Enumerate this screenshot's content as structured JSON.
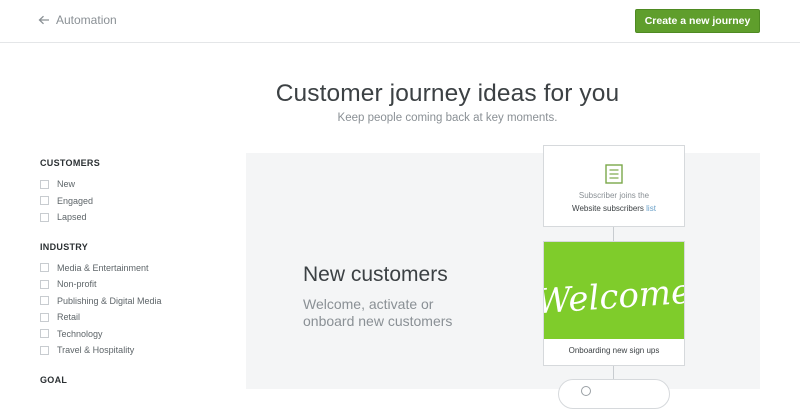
{
  "header": {
    "back_label": "Automation",
    "cta_label": "Create a new journey"
  },
  "hero": {
    "title": "Customer journey ideas for you",
    "subtitle": "Keep people coming back at key moments."
  },
  "filters": {
    "groups": [
      {
        "title": "CUSTOMERS",
        "options": [
          "New",
          "Engaged",
          "Lapsed"
        ]
      },
      {
        "title": "INDUSTRY",
        "options": [
          "Media & Entertainment",
          "Non-profit",
          "Publishing & Digital Media",
          "Retail",
          "Technology",
          "Travel & Hospitality"
        ]
      },
      {
        "title": "GOAL",
        "options": []
      }
    ]
  },
  "feature": {
    "heading": "New customers",
    "description": "Welcome, activate or onboard new customers",
    "trigger": {
      "line1": "Subscriber joins the",
      "line2_prefix": "Website subscribers ",
      "line2_link": "list"
    },
    "email": {
      "image_text": "Welcome",
      "caption": "Onboarding new sign ups",
      "image_color": "#7fcc2b"
    }
  },
  "colors": {
    "accent": "#5f9e2c",
    "panel_bg": "#f4f5f6",
    "link": "#6aa0c8"
  }
}
